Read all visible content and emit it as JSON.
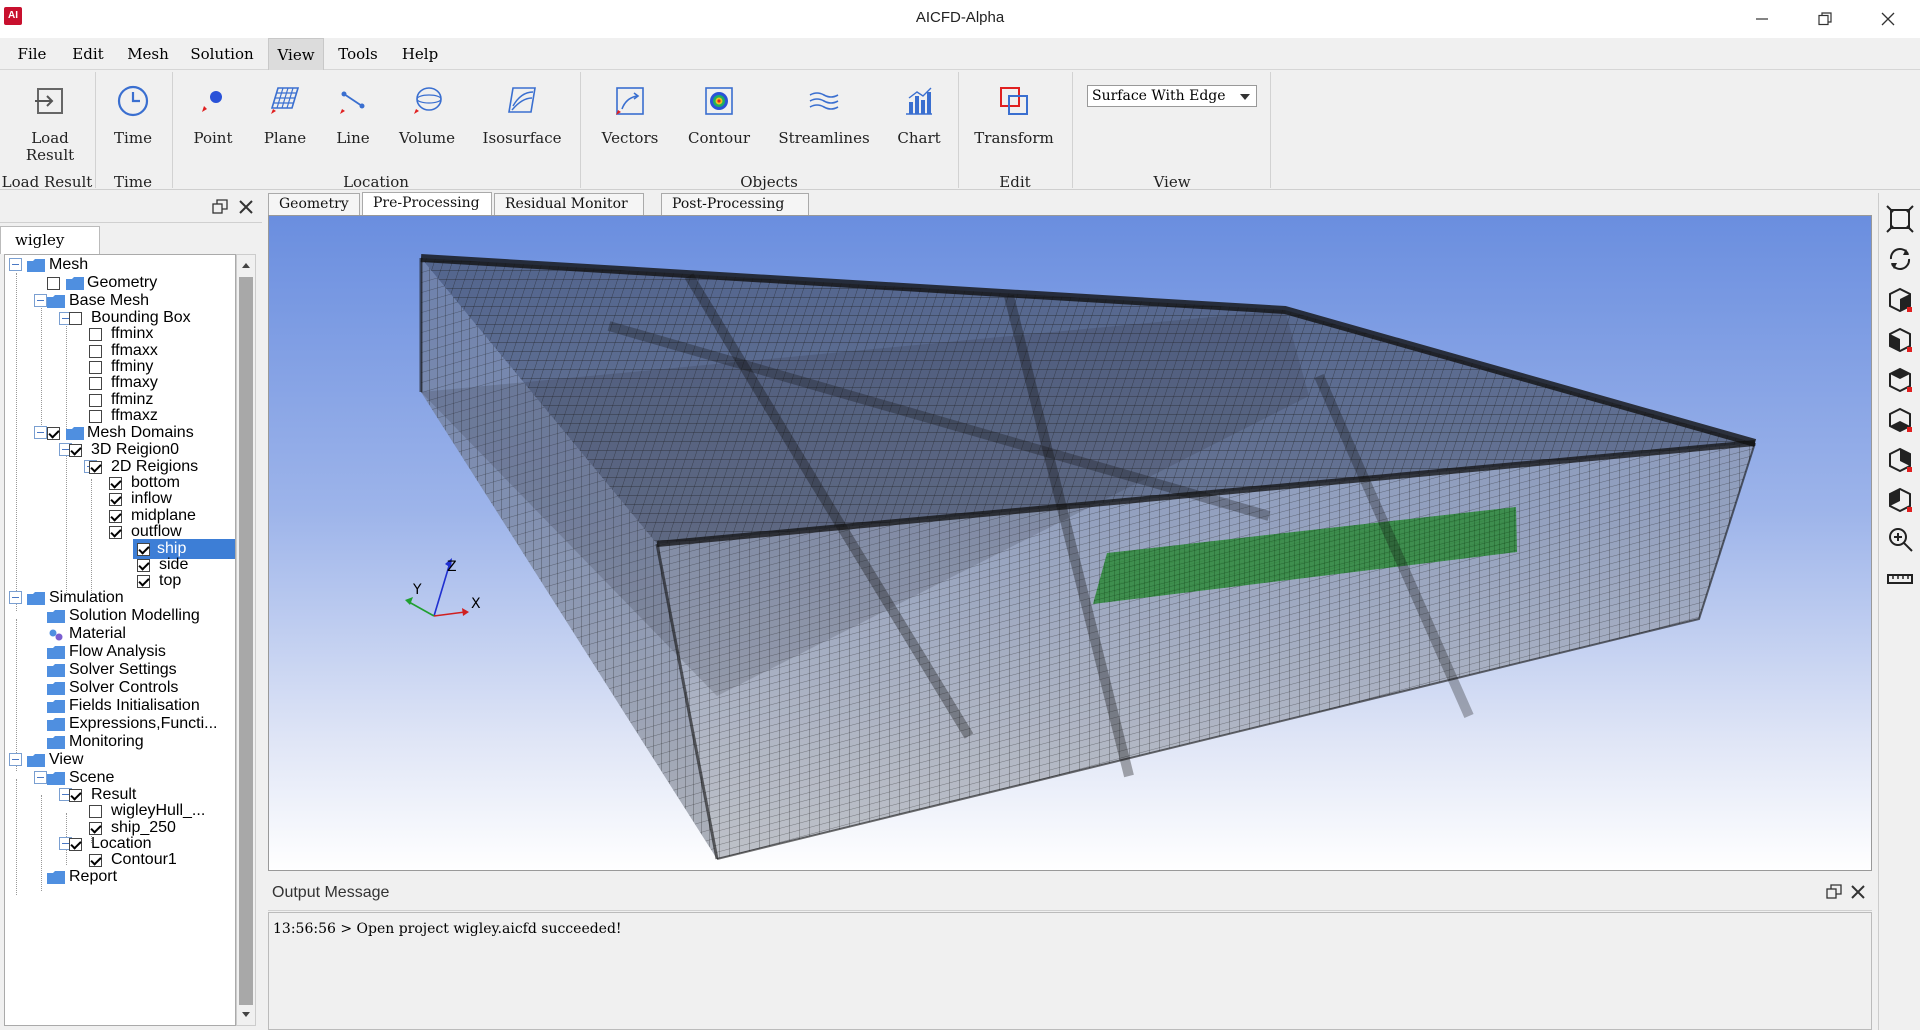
{
  "window": {
    "title": "AICFD-Alpha",
    "icon_text": "AI"
  },
  "menu": {
    "items": [
      "File",
      "Edit",
      "Mesh",
      "Solution",
      "View",
      "Tools",
      "Help"
    ],
    "active": "View"
  },
  "ribbon": {
    "buttons": {
      "load_result": "Load Result",
      "time": "Time",
      "point": "Point",
      "plane": "Plane",
      "line": "Line",
      "volume": "Volume",
      "isosurface": "Isosurface",
      "vectors": "Vectors",
      "contour": "Contour",
      "streamlines": "Streamlines",
      "chart": "Chart",
      "transform": "Transform"
    },
    "groups": {
      "load_result": "Load Result",
      "time": "Time",
      "location": "Location",
      "objects": "Objects",
      "edit": "Edit",
      "view": "View"
    },
    "view_mode": "Surface With Edge"
  },
  "left_panel": {
    "tab": "wigley",
    "tree": {
      "mesh": "Mesh",
      "geometry": "Geometry",
      "base_mesh": "Base Mesh",
      "bounding_box": "Bounding Box",
      "ffminx": "ffminx",
      "ffmaxx": "ffmaxx",
      "ffminy": "ffminy",
      "ffmaxy": "ffmaxy",
      "ffminz": "ffminz",
      "ffmaxz": "ffmaxz",
      "mesh_domains": "Mesh Domains",
      "region3d": "3D Reigion0",
      "regions2d": "2D Reigions",
      "bottom": "bottom",
      "inflow": "inflow",
      "midplane": "midplane",
      "outflow": "outflow",
      "ship": "ship",
      "side": "side",
      "top": "top",
      "simulation": "Simulation",
      "solution_modelling": "Solution Modelling",
      "material": "Material",
      "flow_analysis": "Flow Analysis",
      "solver_settings": "Solver Settings",
      "solver_controls": "Solver Controls",
      "fields_init": "Fields Initialisation",
      "expressions": "Expressions,Functi...",
      "monitoring": "Monitoring",
      "view": "View",
      "scene": "Scene",
      "result": "Result",
      "wigley_hull": "wigleyHull_...",
      "ship_250": "ship_250",
      "location": "Location",
      "contour1": "Contour1",
      "report": "Report"
    }
  },
  "tabs": {
    "geometry": "Geometry",
    "pre": "Pre-Processing",
    "residual": "Residual Monitor",
    "post": "Post-Processing",
    "active": "Pre-Processing"
  },
  "axes": {
    "x": "X",
    "y": "Y",
    "z": "Z"
  },
  "output": {
    "title": "Output Message",
    "message": "13:56:56 > Open project wigley.aicfd succeeded!"
  },
  "colors": {
    "accent": "#3d7ed6",
    "mesh_line": "#1a1a1a",
    "ship_patch": "#2e8a3a",
    "bg_top": "#6a8edf"
  }
}
